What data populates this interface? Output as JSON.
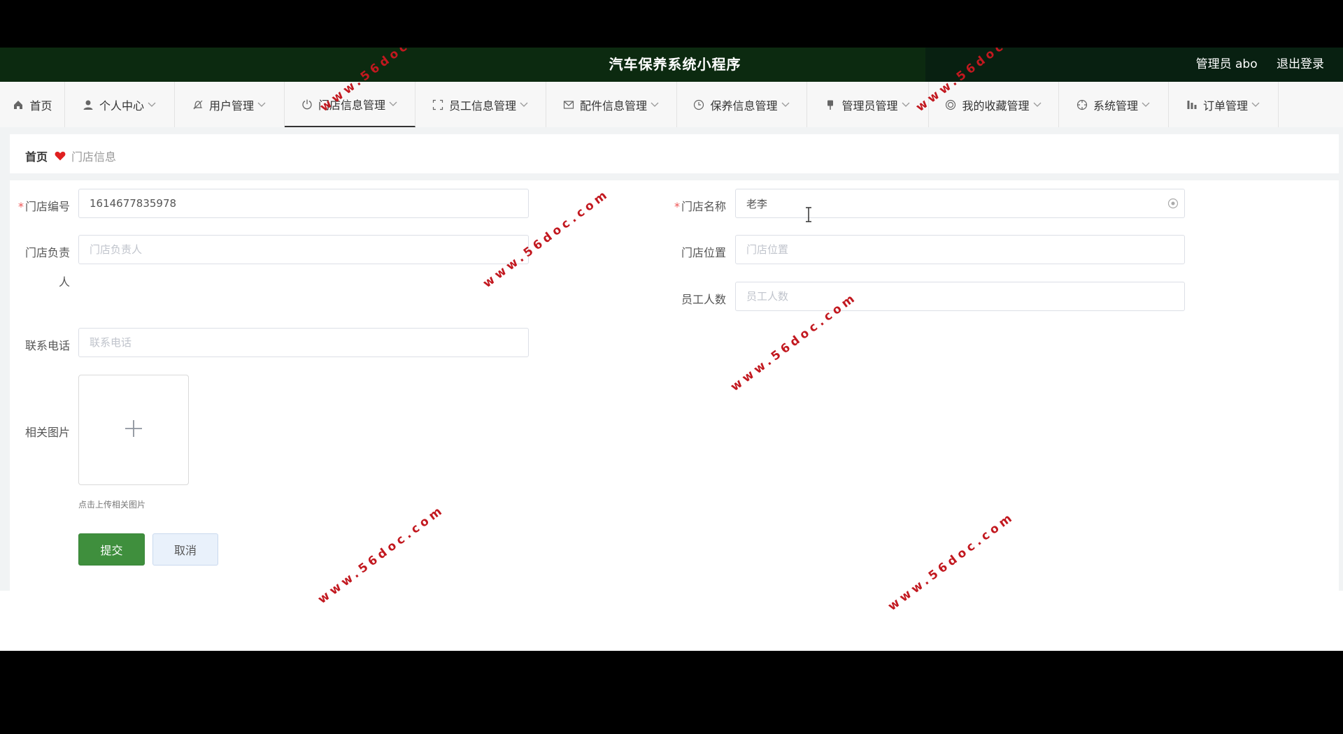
{
  "header": {
    "title": "汽车保养系统小程序",
    "user": "管理员 abo",
    "logout": "退出登录"
  },
  "nav": {
    "items": [
      {
        "label": "首页",
        "icon": "home-icon"
      },
      {
        "label": "个人中心",
        "icon": "user-icon"
      },
      {
        "label": "用户管理",
        "icon": "bell-off-icon"
      },
      {
        "label": "门店信息管理",
        "icon": "power-icon"
      },
      {
        "label": "员工信息管理",
        "icon": "fullscreen-icon"
      },
      {
        "label": "配件信息管理",
        "icon": "mail-icon"
      },
      {
        "label": "保养信息管理",
        "icon": "clock-icon"
      },
      {
        "label": "管理员管理",
        "icon": "pin-icon"
      },
      {
        "label": "我的收藏管理",
        "icon": "target-icon"
      },
      {
        "label": "系统管理",
        "icon": "crosshair-icon"
      },
      {
        "label": "订单管理",
        "icon": "bar-chart-icon"
      }
    ],
    "active_index": 3
  },
  "breadcrumb": {
    "home": "首页",
    "current": "门店信息"
  },
  "form": {
    "store_no": {
      "label": "门店编号",
      "value": "1614677835978",
      "required": true
    },
    "store_name": {
      "label": "门店名称",
      "value": "老李",
      "required": true
    },
    "manager": {
      "label_line1": "门店负责",
      "label_line2": "人",
      "placeholder": "门店负责人"
    },
    "location": {
      "label": "门店位置",
      "placeholder": "门店位置"
    },
    "staff_count": {
      "label": "员工人数",
      "placeholder": "员工人数"
    },
    "phone": {
      "label": "联系电话",
      "placeholder": "联系电话"
    },
    "image": {
      "label": "相关图片",
      "hint": "点击上传相关图片"
    },
    "submit": "提交",
    "cancel": "取消"
  },
  "watermark": "www.56doc.com",
  "colors": {
    "header_bg": "#0c2a10",
    "primary": "#3f8f3d",
    "heart": "#e02020"
  }
}
